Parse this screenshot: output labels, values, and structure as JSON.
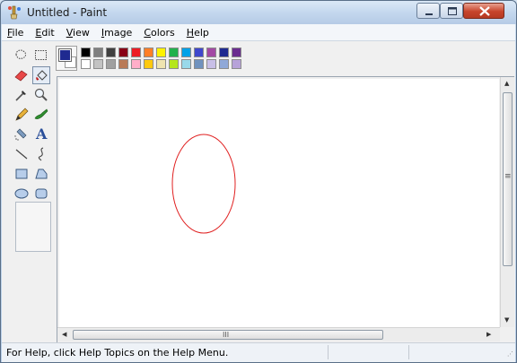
{
  "window": {
    "title": "Untitled - Paint"
  },
  "menu": {
    "items": [
      {
        "accel": "F",
        "rest": "ile"
      },
      {
        "accel": "E",
        "rest": "dit"
      },
      {
        "accel": "V",
        "rest": "iew"
      },
      {
        "accel": "I",
        "rest": "mage"
      },
      {
        "accel": "C",
        "rest": "olors"
      },
      {
        "accel": "H",
        "rest": "elp"
      }
    ]
  },
  "tools": [
    "free-form-select-icon",
    "rectangle-select-icon",
    "eraser-icon",
    "fill-bucket-icon",
    "color-picker-icon",
    "magnifier-icon",
    "pencil-icon",
    "brush-icon",
    "airbrush-icon",
    "text-icon",
    "line-icon",
    "curve-icon",
    "rectangle-icon",
    "polygon-icon",
    "ellipse-icon",
    "rounded-rectangle-icon"
  ],
  "text_tool_glyph": "A",
  "selected_tool": "fill-bucket-icon",
  "palette": {
    "foreground": "#1f2a90",
    "background": "#ffffff",
    "row1": [
      "#000000",
      "#7f7f7f",
      "#404040",
      "#880015",
      "#ed1c24",
      "#ff7f27",
      "#fff200",
      "#22b14c",
      "#00a2e8",
      "#3f48cc",
      "#a349a4",
      "#1f2a90",
      "#6a2c8f"
    ],
    "row2": [
      "#ffffff",
      "#c3c3c3",
      "#a0a0a0",
      "#b97a57",
      "#ffaec9",
      "#ffc90e",
      "#efe4b0",
      "#b5e61d",
      "#99d9ea",
      "#7092be",
      "#c8bfe7",
      "#8fa8d8",
      "#b7a2d9"
    ]
  },
  "drawing": {
    "shape": "ellipse",
    "stroke": "#e02020"
  },
  "scrollbars": {
    "h_grip": "III",
    "v_grip": "≡"
  },
  "status": {
    "text": "For Help, click Help Topics on the Help Menu."
  }
}
